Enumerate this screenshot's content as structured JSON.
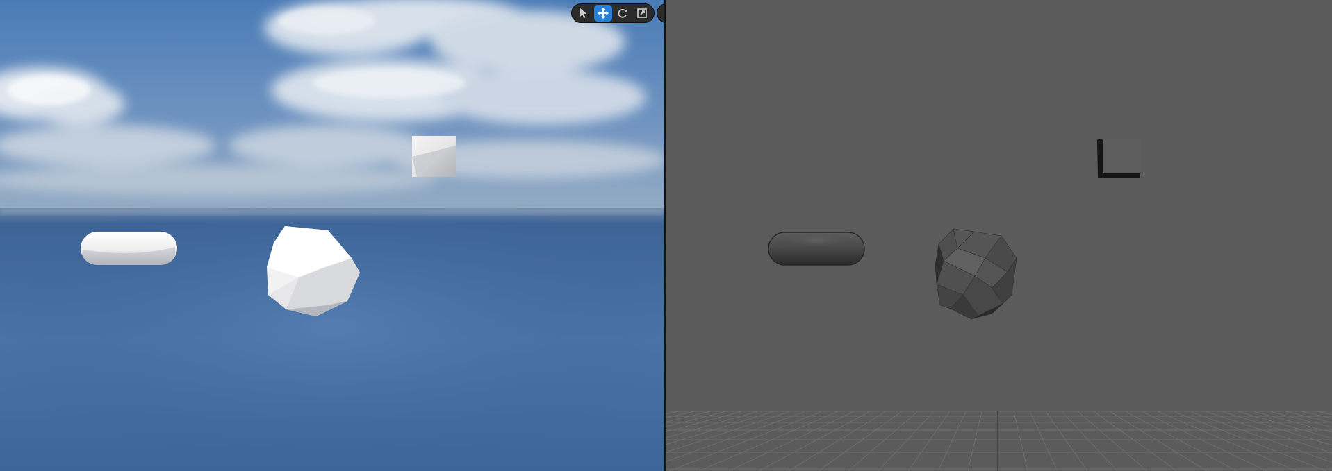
{
  "viewports": {
    "perspective": {
      "sky_top_color": "#4f7fb7",
      "horizon_color": "#8fa6bf",
      "ground_color": "#4670a2",
      "objects": [
        "capsule",
        "icosphere",
        "cube"
      ]
    },
    "reference": {
      "background_color": "#5b5b5b",
      "grid_line_color": "#6e6e6e",
      "objects": [
        "capsule",
        "icosphere",
        "cube"
      ]
    }
  },
  "toolbar": {
    "tools": [
      {
        "name": "select",
        "icon": "cursor-icon",
        "active": false
      },
      {
        "name": "translate",
        "icon": "move-arrows-icon",
        "active": true
      },
      {
        "name": "rotate",
        "icon": "rotate-icon",
        "active": false
      },
      {
        "name": "scale",
        "icon": "scale-icon",
        "active": false
      }
    ],
    "active_color": "#2a7fd6"
  }
}
